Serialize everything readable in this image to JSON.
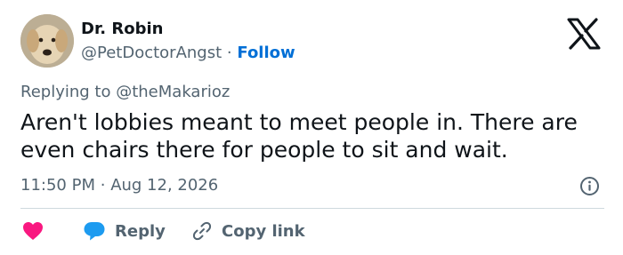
{
  "author": {
    "display_name": "Dr. Robin",
    "handle": "@PetDoctorAngst",
    "separator": "·",
    "follow_label": "Follow"
  },
  "reply_context": {
    "prefix": "Replying to",
    "mention": "@theMakarioz"
  },
  "tweet": {
    "lines": [
      "Aren't lobbies meant to meet people in. There are",
      "even chairs there for people to sit and wait."
    ],
    "time": "11:50 PM",
    "separator": "·",
    "date": "Aug 12, 2026"
  },
  "actions": {
    "reply_label": "Reply",
    "copy_link_label": "Copy link"
  },
  "icons": {
    "brand": "x-logo-icon",
    "info": "info-icon",
    "like": "heart-icon",
    "reply": "speech-bubble-icon",
    "copy": "link-icon"
  },
  "colors": {
    "follow": "#006fd6",
    "heart": "#f91880",
    "reply_bubble": "#1d9bf0",
    "secondary_text": "#536471"
  }
}
